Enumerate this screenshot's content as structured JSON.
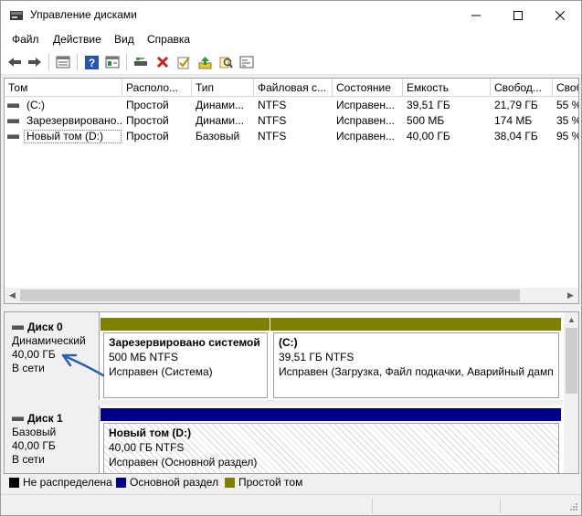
{
  "window": {
    "title": "Управление дисками"
  },
  "menu": [
    "Файл",
    "Действие",
    "Вид",
    "Справка"
  ],
  "toolbar": {
    "icons": [
      "back-arrow-icon",
      "forward-arrow-icon",
      "volume-list-icon",
      "help-icon",
      "properties-icon",
      "connect-icon",
      "delete-icon",
      "check-icon",
      "upload-icon",
      "search-icon",
      "settings-icon"
    ]
  },
  "volume_list": {
    "columns": [
      "Том",
      "Располо...",
      "Тип",
      "Файловая с...",
      "Состояние",
      "Емкость",
      "Свобод...",
      "Своб"
    ],
    "rows": [
      [
        "(C:)",
        "Простой",
        "Динами...",
        "NTFS",
        "Исправен...",
        "39,51 ГБ",
        "21,79 ГБ",
        "55 %"
      ],
      [
        "Зарезервировано...",
        "Простой",
        "Динами...",
        "NTFS",
        "Исправен...",
        "500 МБ",
        "174 МБ",
        "35 %"
      ],
      [
        "Новый том (D:)",
        "Простой",
        "Базовый",
        "NTFS",
        "Исправен...",
        "40,00 ГБ",
        "38,04 ГБ",
        "95 %"
      ]
    ]
  },
  "disks": [
    {
      "title": "Диск 0",
      "type": "Динамический",
      "size": "40,00 ГБ",
      "status": "В сети",
      "partitions": [
        {
          "title": "Зарезервировано системой",
          "size": "500 МБ NTFS",
          "status": "Исправен (Система)",
          "color": "#808000"
        },
        {
          "title": "(C:)",
          "size": "39,51 ГБ NTFS",
          "status": "Исправен (Загрузка, Файл подкачки, Аварийный дамп",
          "color": "#808000"
        }
      ]
    },
    {
      "title": "Диск 1",
      "type": "Базовый",
      "size": "40,00 ГБ",
      "status": "В сети",
      "partitions": [
        {
          "title": "Новый том  (D:)",
          "size": "40,00 ГБ NTFS",
          "status": "Исправен (Основной раздел)",
          "color": "#00008b"
        }
      ]
    }
  ],
  "legend": [
    {
      "label": "Не распределена",
      "color": "#000000"
    },
    {
      "label": "Основной раздел",
      "color": "#00008b"
    },
    {
      "label": "Простой том",
      "color": "#808000"
    }
  ]
}
